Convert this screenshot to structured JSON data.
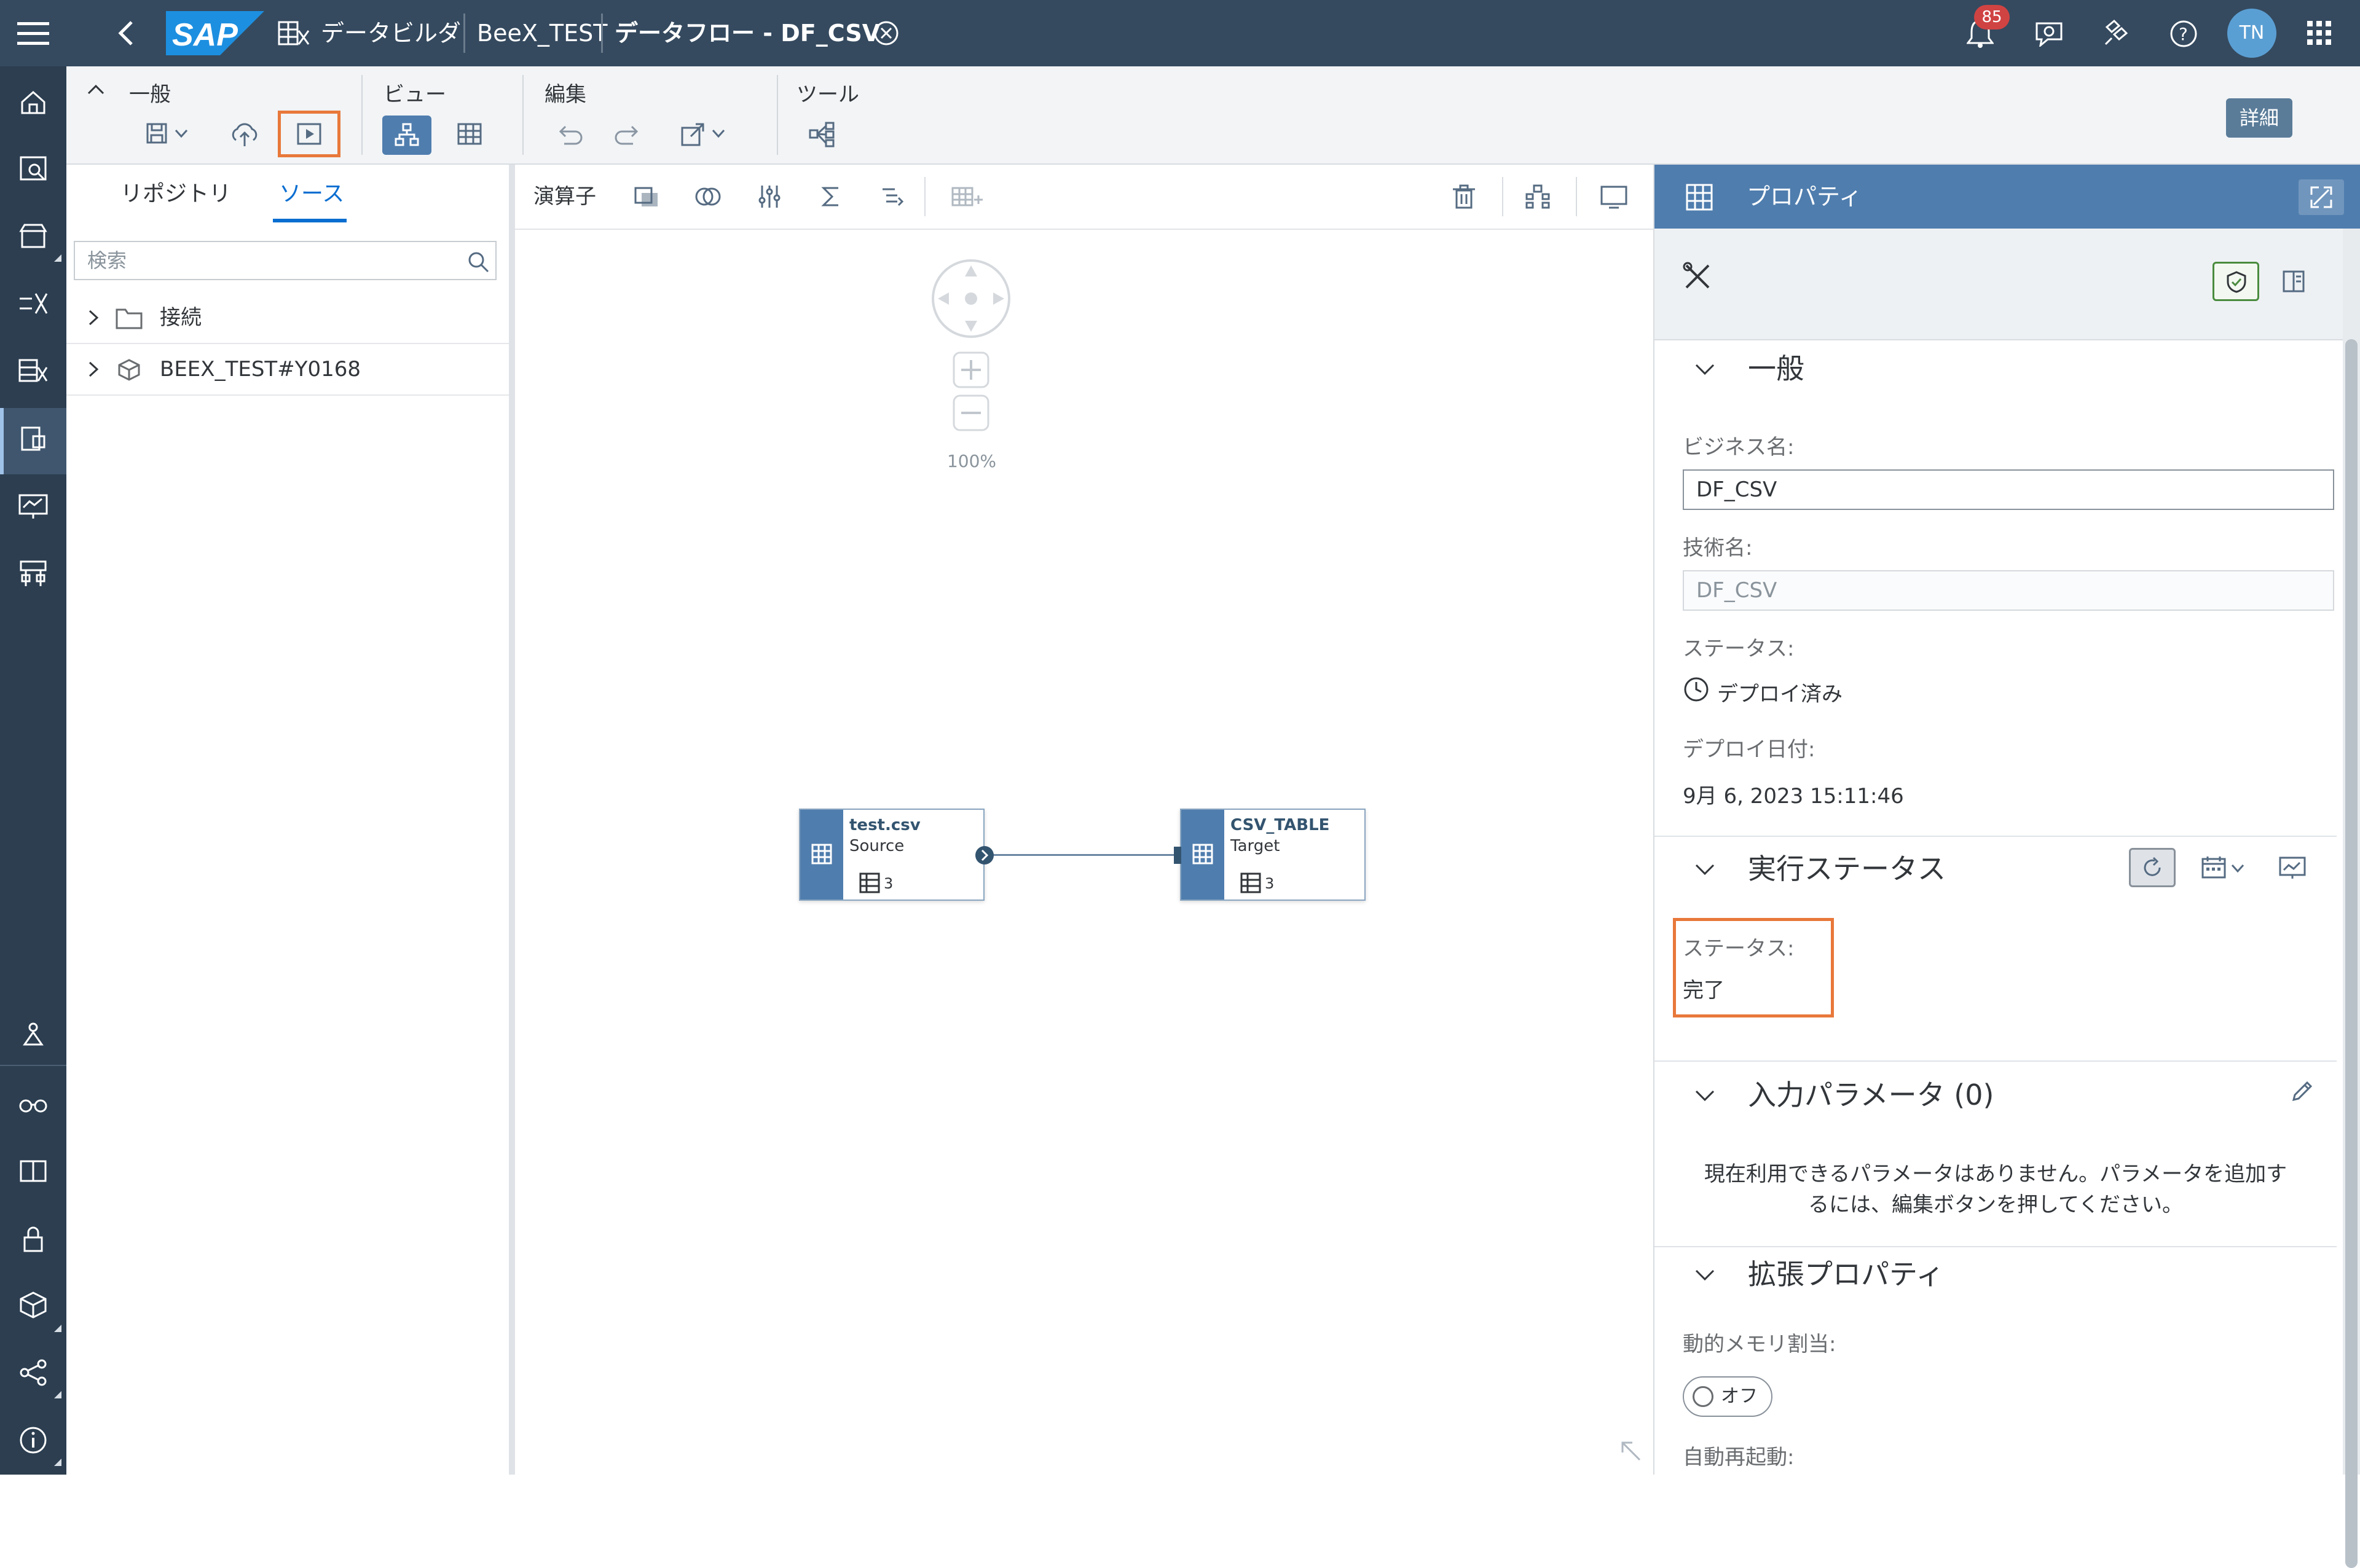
{
  "shell": {
    "logo": "SAP",
    "breadcrumb_app": "データビルダ",
    "breadcrumb_space": "BeeX_TEST",
    "title": "データフロー - DF_CSV",
    "notification_count": "85",
    "user_initials": "TN"
  },
  "toolbar": {
    "groups": {
      "general": "一般",
      "view": "ビュー",
      "edit": "編集",
      "tools": "ツール"
    },
    "detail_button": "詳細"
  },
  "left_panel": {
    "tabs": [
      "リポジトリ",
      "ソース"
    ],
    "selected_tab": 1,
    "search_placeholder": "検索",
    "tree": [
      {
        "label": "接続",
        "icon": "folder-icon"
      },
      {
        "label": "BEEX_TEST#Y0168",
        "icon": "cube-icon"
      }
    ]
  },
  "canvas": {
    "toolbar_label": "演算子",
    "zoom": "100%",
    "nodes": [
      {
        "name": "test.csv",
        "role": "Source",
        "columns": "3"
      },
      {
        "name": "CSV_TABLE",
        "role": "Target",
        "columns": "3"
      }
    ]
  },
  "properties": {
    "header": "プロパティ",
    "general": {
      "title": "一般",
      "business_name_label": "ビジネス名:",
      "business_name": "DF_CSV",
      "technical_name_label": "技術名:",
      "technical_name": "DF_CSV",
      "status_label": "ステータス:",
      "status_value": "デプロイ済み",
      "deploy_date_label": "デプロイ日付:",
      "deploy_date": "9月 6, 2023 15:11:46"
    },
    "run_status": {
      "title": "実行ステータス",
      "status_label": "ステータス:",
      "status_value": "完了"
    },
    "input_params": {
      "title": "入力パラメータ (0)",
      "empty_text_1": "現在利用できるパラメータはありません。パラメータを追加す",
      "empty_text_2": "るには、編集ボタンを押してください。"
    },
    "extended": {
      "title": "拡張プロパティ",
      "dynamic_memory_label": "動的メモリ割当:",
      "toggle_text": "オフ",
      "auto_restart_label": "自動再起動:"
    }
  },
  "colors": {
    "shell": "#354a5f",
    "accent": "#4f7dae",
    "highlight": "#e8783a",
    "badge": "#d04343"
  }
}
